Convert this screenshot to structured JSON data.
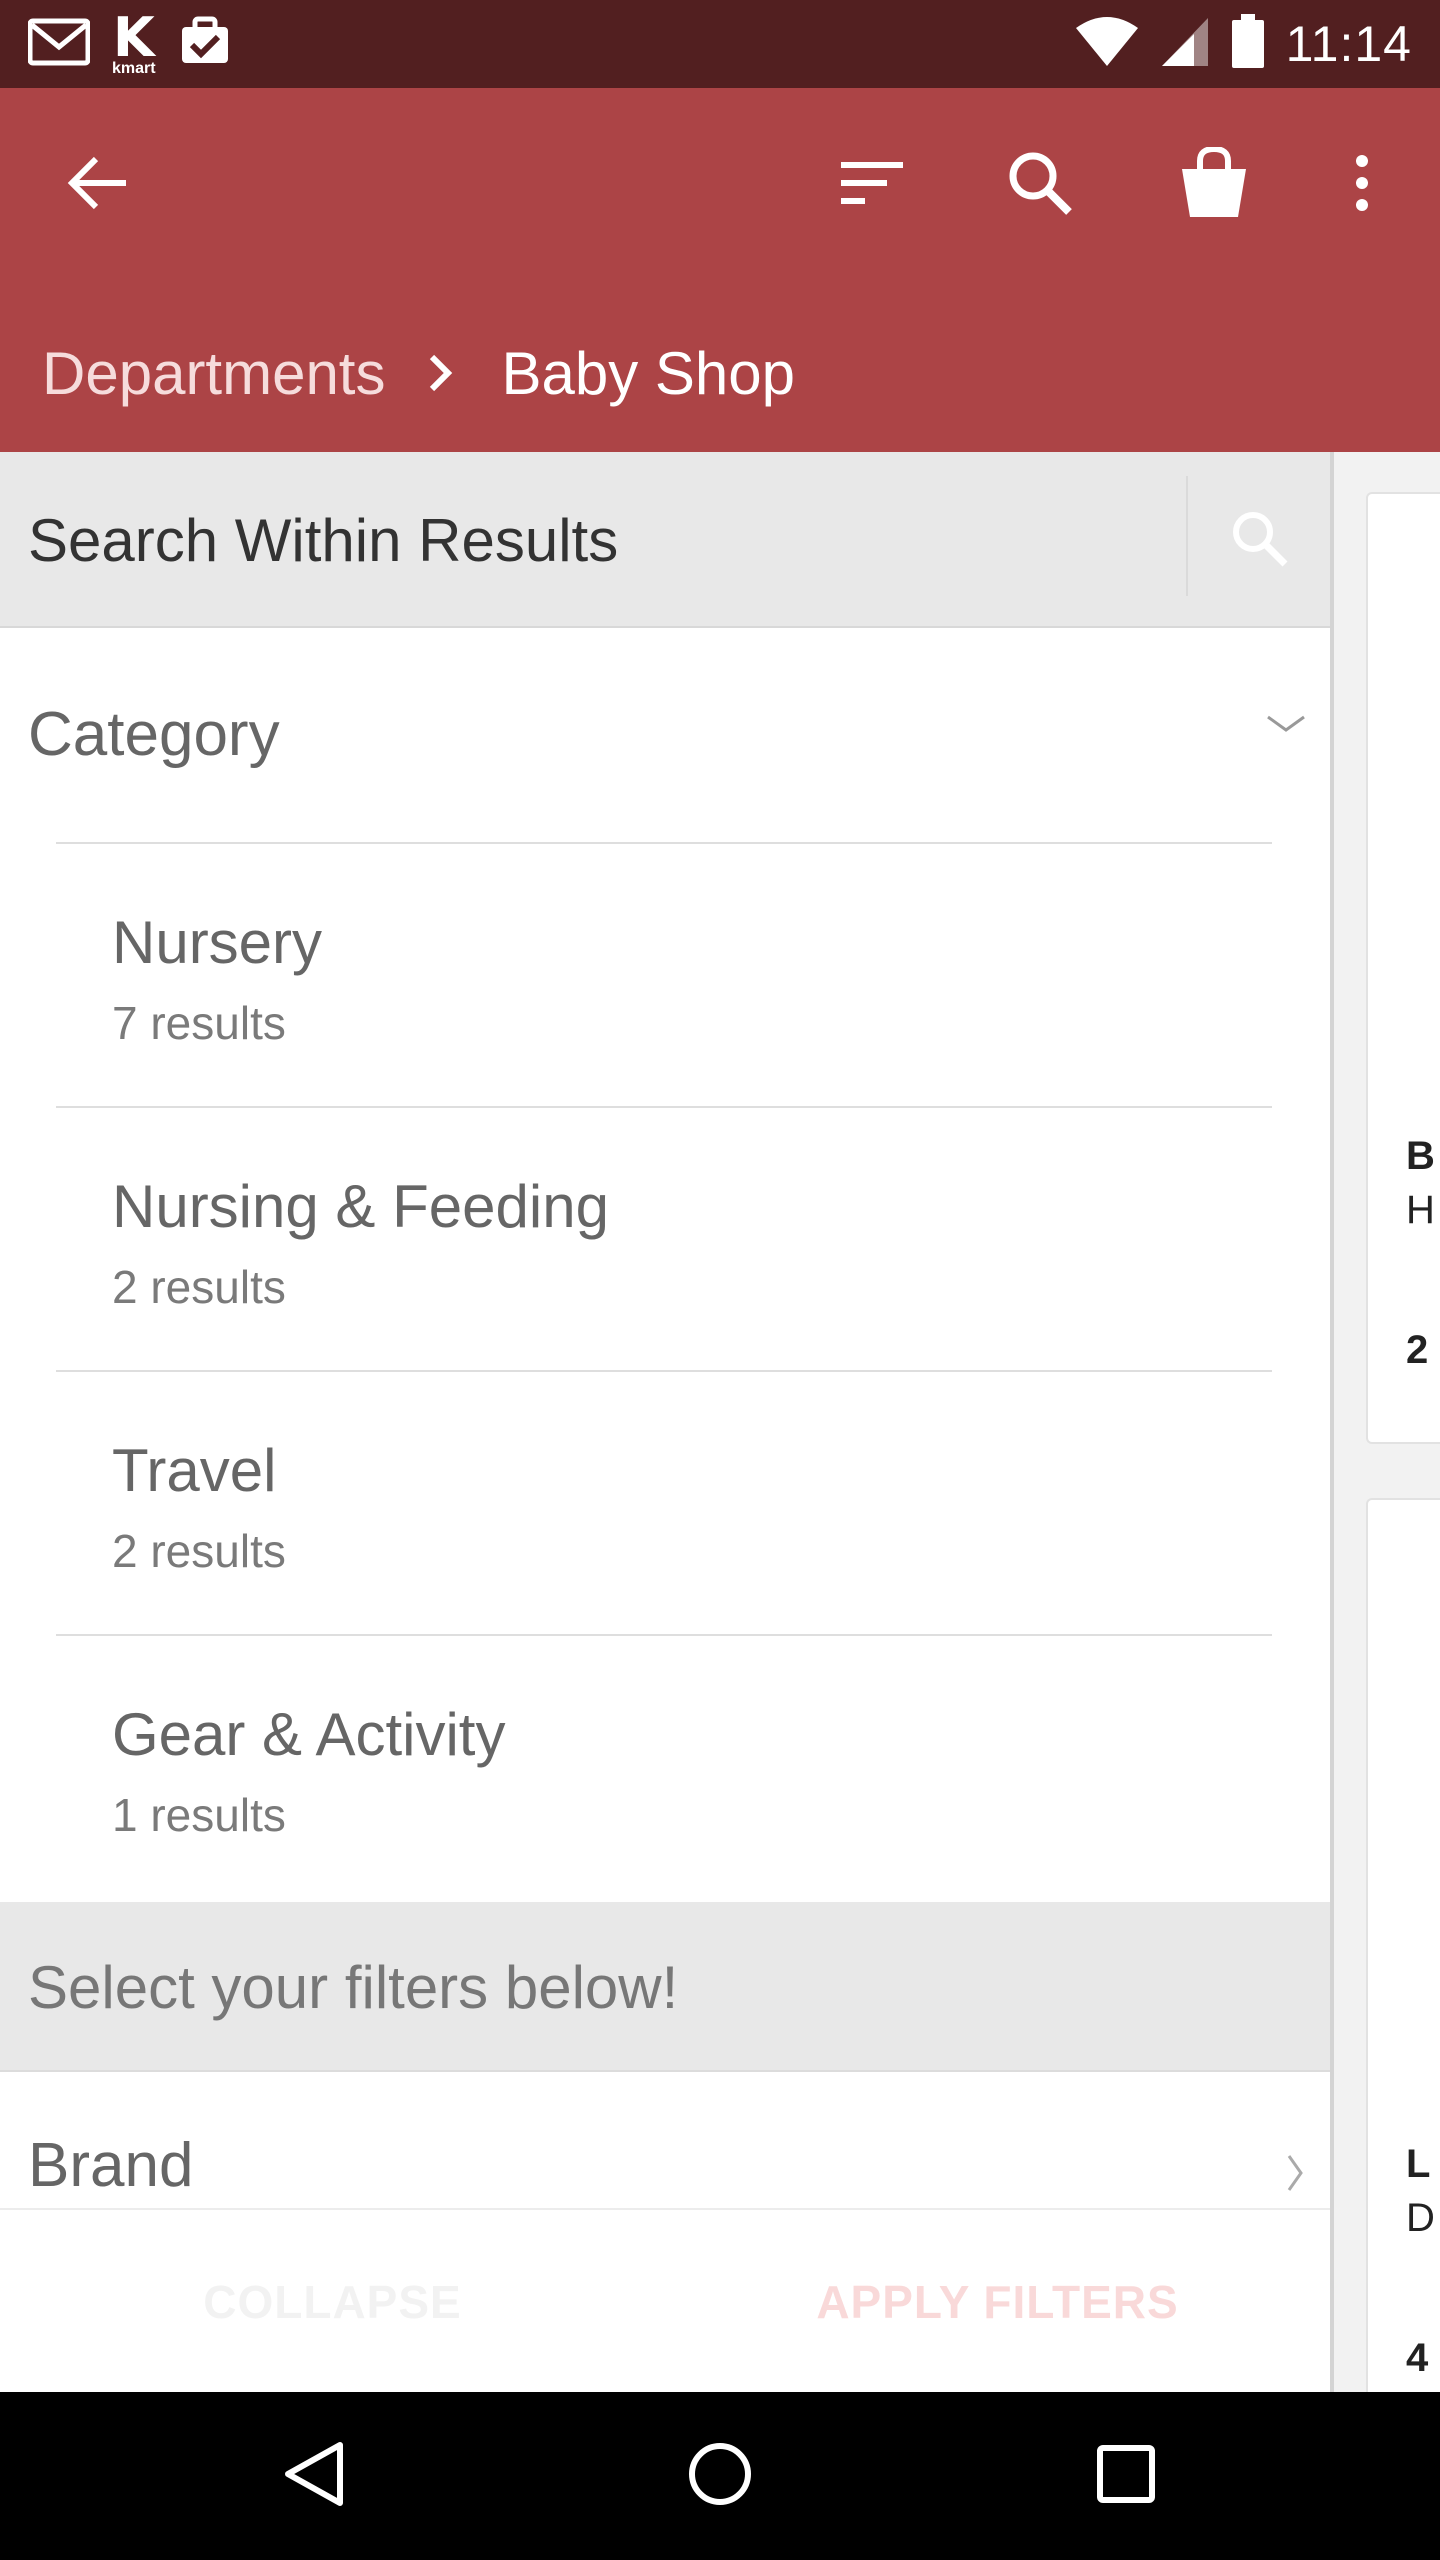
{
  "status_bar": {
    "time": "11:14",
    "kmart_logo_letter": "K",
    "kmart_logo_word": "kmart",
    "icons": [
      "gmail-icon",
      "kmart-app-icon",
      "task-check-icon",
      "wifi-icon",
      "signal-icon",
      "battery-icon"
    ]
  },
  "app_bar": {
    "background_color": "#ac4446",
    "icons": [
      "back-arrow-icon",
      "sort-icon",
      "search-icon",
      "shopping-bag-icon",
      "more-vert-icon"
    ],
    "breadcrumb": {
      "parent": "Departments",
      "current": "Baby Shop"
    }
  },
  "filter_drawer": {
    "search": {
      "placeholder": "Search Within Results"
    },
    "category": {
      "title": "Category",
      "items": [
        {
          "name": "Nursery",
          "count": "7 results"
        },
        {
          "name": "Nursing & Feeding",
          "count": "2 results"
        },
        {
          "name": "Travel",
          "count": "2 results"
        },
        {
          "name": "Gear & Activity",
          "count": "1 results"
        }
      ]
    },
    "filters_banner": "Select your filters below!",
    "brand": {
      "title": "Brand"
    },
    "actions": {
      "collapse": "COLLAPSE",
      "apply": "APPLY FILTERS"
    }
  },
  "product_peek": {
    "card1": {
      "line1": "B",
      "line2": "H",
      "line3": "2"
    },
    "card2": {
      "line1": "L",
      "line2": "D",
      "line3": "4"
    }
  }
}
